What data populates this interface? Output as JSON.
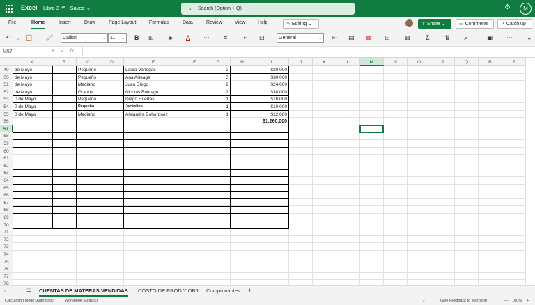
{
  "titlebar": {
    "app_name": "Excel",
    "doc_title": "Libro 3 ᴿᴬ - Saved ⌄",
    "search_placeholder": "Search (Option + Q)",
    "settings_icon": "gear-icon",
    "avatar_initial": "M"
  },
  "menubar": {
    "items": [
      "File",
      "Home",
      "Insert",
      "Draw",
      "Page Layout",
      "Formulas",
      "Data",
      "Review",
      "View",
      "Help"
    ],
    "active": "Home",
    "editing_label": "Editing",
    "share_label": "Share",
    "comments_label": "Comments",
    "catchup_label": "Catch up"
  },
  "ribbon": {
    "font_name": "Calibri",
    "font_size": "11",
    "number_format": "General",
    "bold_label": "B"
  },
  "formula_bar": {
    "name_box": "M57",
    "fx_label": "fx",
    "formula": ""
  },
  "sheet": {
    "columns": [
      "A",
      "B",
      "C",
      "D",
      "E",
      "F",
      "G",
      "H",
      "I",
      "J",
      "K",
      "L",
      "M",
      "N",
      "O",
      "P",
      "Q",
      "R",
      "S"
    ],
    "selected_column": "M",
    "selected_row": "57",
    "rows": [
      "49",
      "50",
      "51",
      "52",
      "53",
      "54",
      "55",
      "56",
      "57",
      "58",
      "59",
      "60",
      "61",
      "62",
      "63",
      "64",
      "65",
      "66",
      "67",
      "68",
      "69",
      "70",
      "71",
      "72",
      "73",
      "74",
      "75",
      "76",
      "77",
      "78"
    ],
    "data_rows": [
      {
        "a": "de Mayo",
        "c": "Pequeño",
        "e": "Laura Vanegas",
        "g": "2",
        "i": "$20,000"
      },
      {
        "a": "de Mayo",
        "c": "Pequeño",
        "e": "Ana Arteaga",
        "g": "3",
        "i": "$30,000"
      },
      {
        "a": "de Mayo",
        "c": "Mediano",
        "e": "Juan Diego",
        "g": "2",
        "i": "$24,000"
      },
      {
        "a": "de Mayo",
        "c": "Grande",
        "e": "Nicolas Buitrago",
        "g": "2",
        "i": "$30,000"
      },
      {
        "a": "0 de Mayo",
        "c": "Pequeño",
        "e": "Diego Huertas",
        "g": "1",
        "i": "$10,000"
      },
      {
        "a": "0 de Mayo",
        "c": "Pequeño",
        "e": "Jackeline",
        "g": "1",
        "i": "$10,000",
        "small": true
      },
      {
        "a": "0 de Mayo",
        "c": "Mediano",
        "e": "Alejandra Bohorquez",
        "g": "1",
        "i": "$12,000"
      }
    ],
    "total": "$1,260,000"
  },
  "tabs": {
    "sheets": [
      "CUENTAS DE MATERAS VENDIDAS",
      "COSTO DE PROD Y OBJ.",
      "Comprovantes"
    ],
    "active": "CUENTAS DE MATERAS VENDIDAS",
    "add_label": "+"
  },
  "status": {
    "calc_mode": "Calculation Mode: Automatic",
    "workbook_stats": "Workbook Statistics",
    "feedback": "Give Feedback to Microsoft",
    "zoom": "100%"
  },
  "colors": {
    "accent": "#107c41",
    "ribbon_bg": "#f3f3f3"
  }
}
